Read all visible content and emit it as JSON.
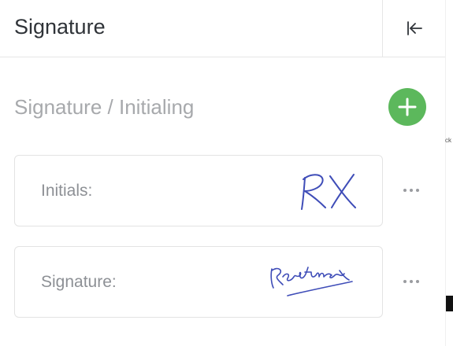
{
  "header": {
    "title": "Signature",
    "collapse_icon": "collapse-left-icon"
  },
  "section": {
    "title": "Signature / Initialing",
    "add_icon": "plus-icon",
    "add_color": "#5cb85c"
  },
  "items": [
    {
      "label": "Initials:",
      "drawn_mark": "RX",
      "menu_icon": "more-horizontal-icon"
    },
    {
      "label": "Signature:",
      "drawn_mark": "Rastinex",
      "menu_icon": "more-horizontal-icon"
    }
  ],
  "edge_fragment": "ck",
  "colors": {
    "ink": "#3f4db8",
    "text": "#2f3338",
    "muted": "#a7a9ac"
  }
}
